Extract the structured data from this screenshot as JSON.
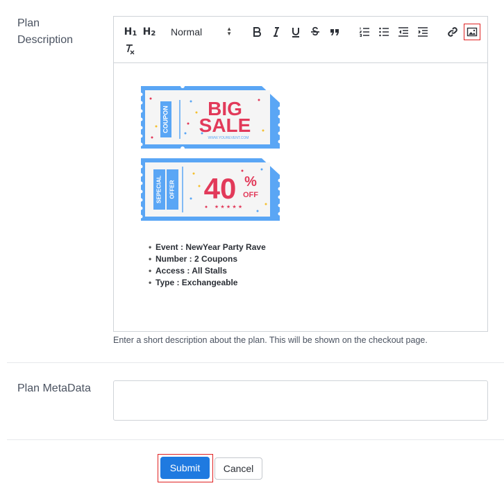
{
  "fields": {
    "description_label": "Plan Description",
    "metadata_label": "Plan MetaData",
    "description_help": "Enter a short description about the plan. This will be shown on the checkout page.",
    "metadata_value": ""
  },
  "toolbar": {
    "h1": "H",
    "h1_sub": "1",
    "h2": "H",
    "h2_sub": "2",
    "format_value": "Normal",
    "icons": [
      "header-1-icon",
      "header-2-icon",
      "bold-icon",
      "italic-icon",
      "underline-icon",
      "strikethrough-icon",
      "blockquote-icon",
      "ordered-list-icon",
      "bullet-list-icon",
      "outdent-icon",
      "indent-icon",
      "link-icon",
      "image-icon",
      "clear-format-icon"
    ]
  },
  "editor": {
    "coupon1": {
      "label": "COUPON",
      "title_line1": "BIG",
      "title_line2": "SALE",
      "url": "WWW.YOUREVENT.COM"
    },
    "coupon2": {
      "label_line1": "SEPECIAL",
      "label_line2": "OFFER",
      "percent": "40",
      "percent_sign": "%",
      "off": "OFF",
      "stars": "★ ★ ★ ★ ★"
    },
    "list": [
      "Event : NewYear Party Rave",
      "Number : 2 Coupons",
      "Access : All Stalls",
      "Type : Exchangeable"
    ]
  },
  "actions": {
    "submit": "Submit",
    "cancel": "Cancel"
  },
  "colors": {
    "accent": "#1f7ae0",
    "highlight": "#e02020",
    "coupon_blue": "#5aa6f5",
    "coupon_red": "#e23a5a"
  }
}
